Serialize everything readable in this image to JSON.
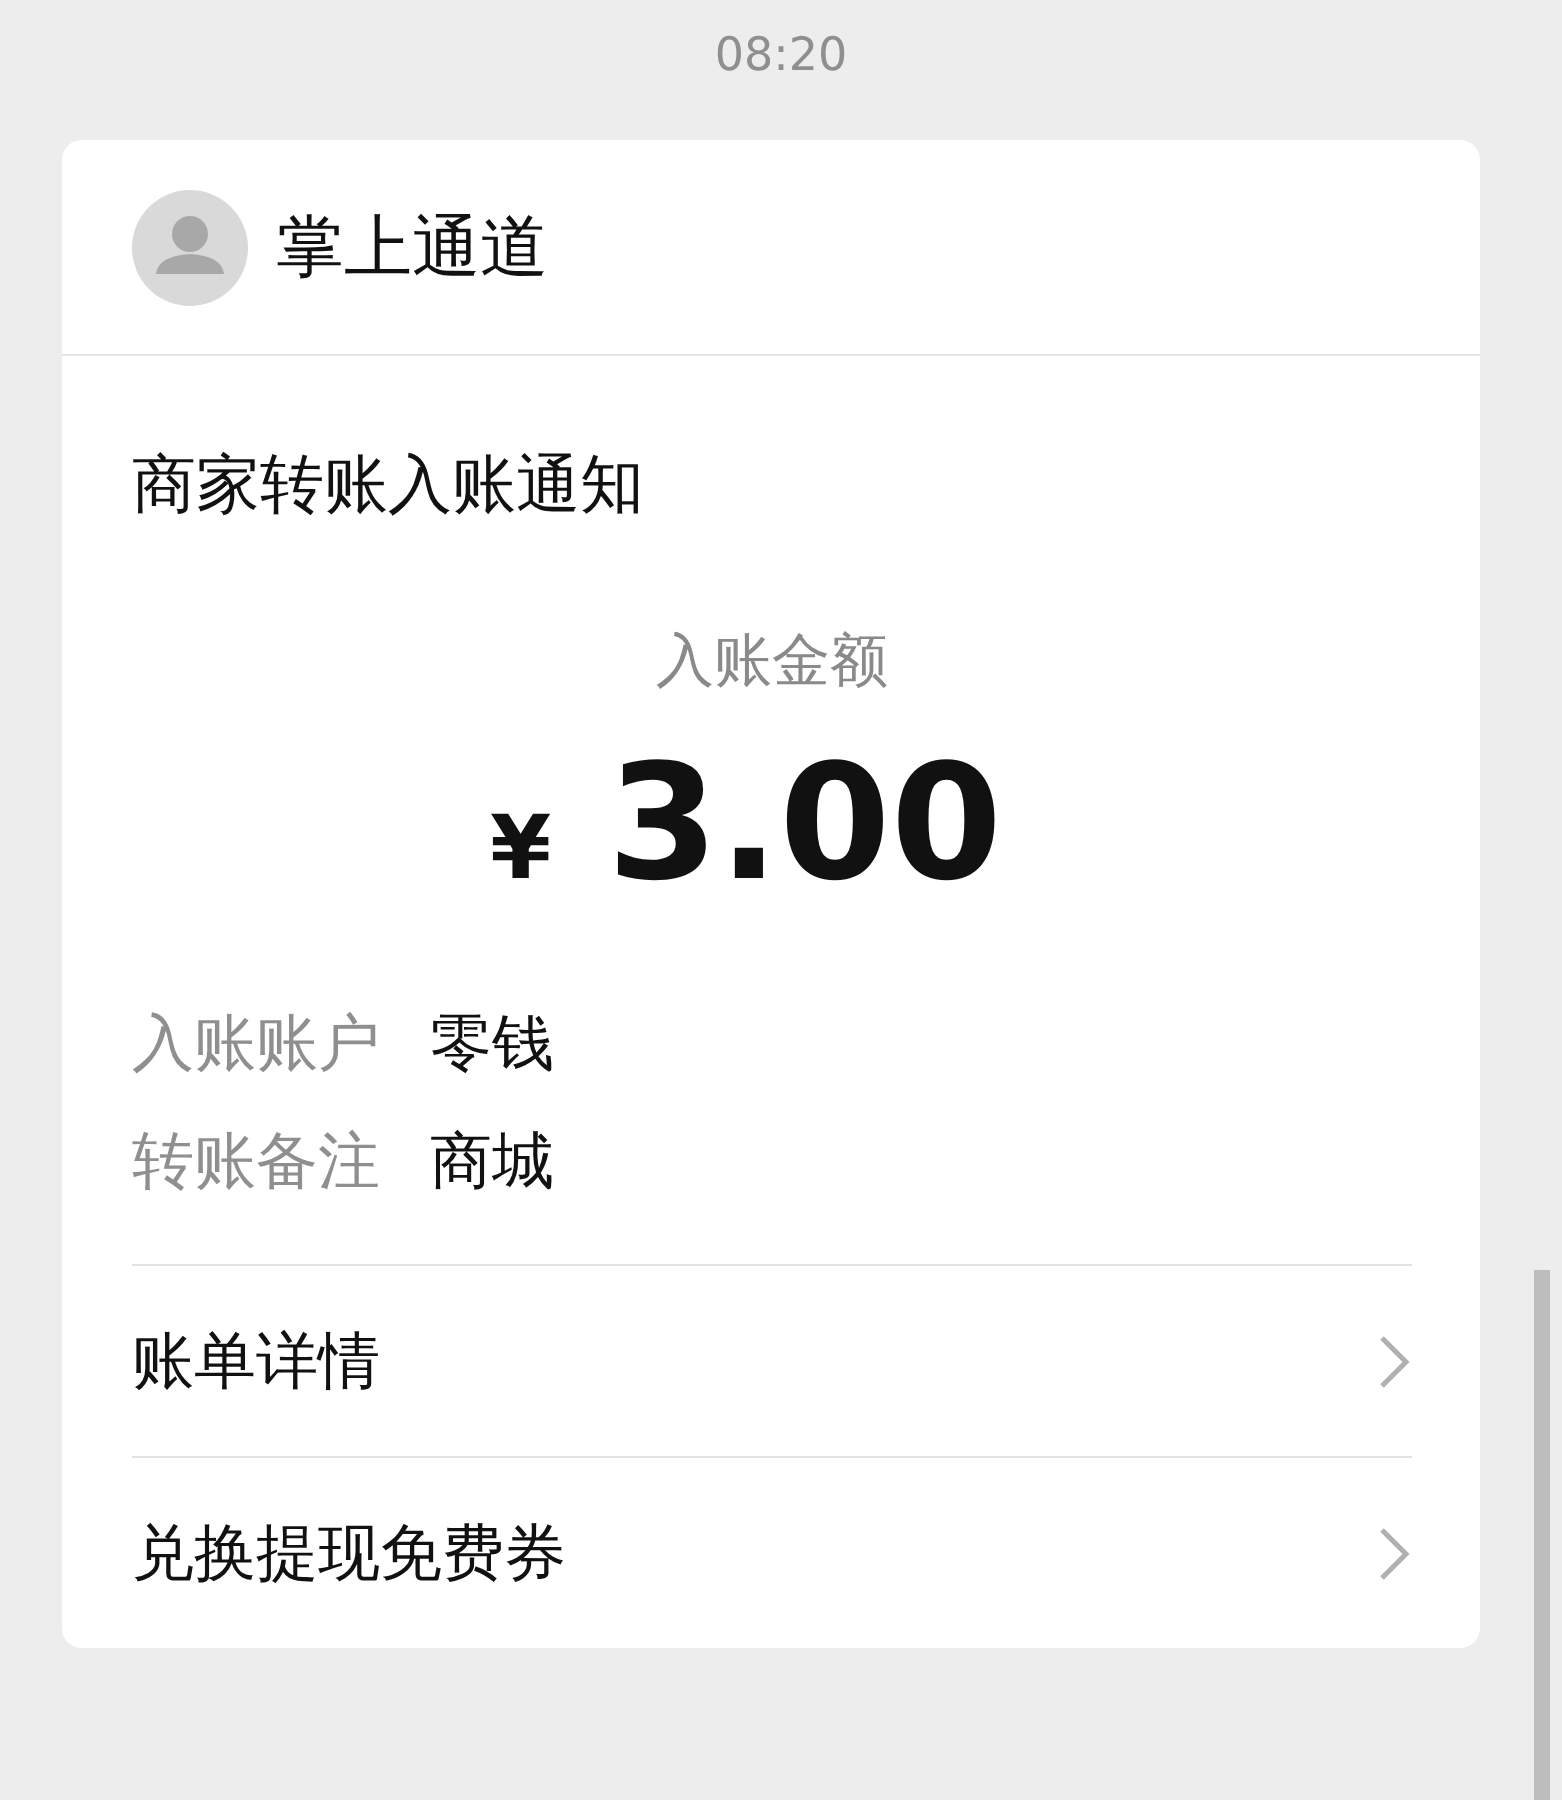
{
  "time": "08:20",
  "sender": {
    "name": "掌上通道"
  },
  "message": {
    "title": "商家转账入账通知",
    "amount_label": "入账金额",
    "currency": "¥",
    "amount": "3.00",
    "details": [
      {
        "label": "入账账户",
        "value": "零钱"
      },
      {
        "label": "转账备注",
        "value": "商城"
      }
    ],
    "links": [
      {
        "label": "账单详情"
      },
      {
        "label": "兑换提现免费券"
      }
    ]
  }
}
